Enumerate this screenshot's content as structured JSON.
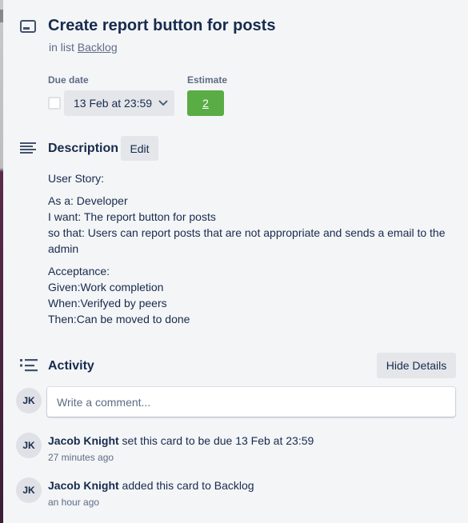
{
  "card": {
    "title": "Create report button for posts",
    "list_prefix": "in list",
    "list_name": "Backlog"
  },
  "fields": {
    "due_label": "Due date",
    "due_value": "13 Feb at 23:59",
    "estimate_label": "Estimate",
    "estimate_value": "2",
    "estimate_color": "#5aac44"
  },
  "description": {
    "heading": "Description",
    "edit_label": "Edit",
    "lines": [
      "User Story:",
      "As a: Developer",
      "I want: The report button for posts",
      "so that: Users can report posts that are not appropriate and sends a email to the admin",
      "Acceptance:",
      "Given:Work completion",
      "When:Verifyed by peers",
      "Then:Can be moved to done"
    ]
  },
  "activity": {
    "heading": "Activity",
    "hide_details_label": "Hide Details",
    "current_user_initials": "JK",
    "comment_placeholder": "Write a comment...",
    "entries": [
      {
        "initials": "JK",
        "user": "Jacob Knight",
        "action": " set this card to be due 13 Feb at 23:59",
        "time": "27 minutes ago"
      },
      {
        "initials": "JK",
        "user": "Jacob Knight",
        "action": " added this card to Backlog",
        "time": "an hour ago"
      }
    ]
  },
  "icons": {
    "card": "card-icon",
    "description": "description-icon",
    "activity": "activity-icon",
    "chevron": "chevron-down-icon"
  }
}
